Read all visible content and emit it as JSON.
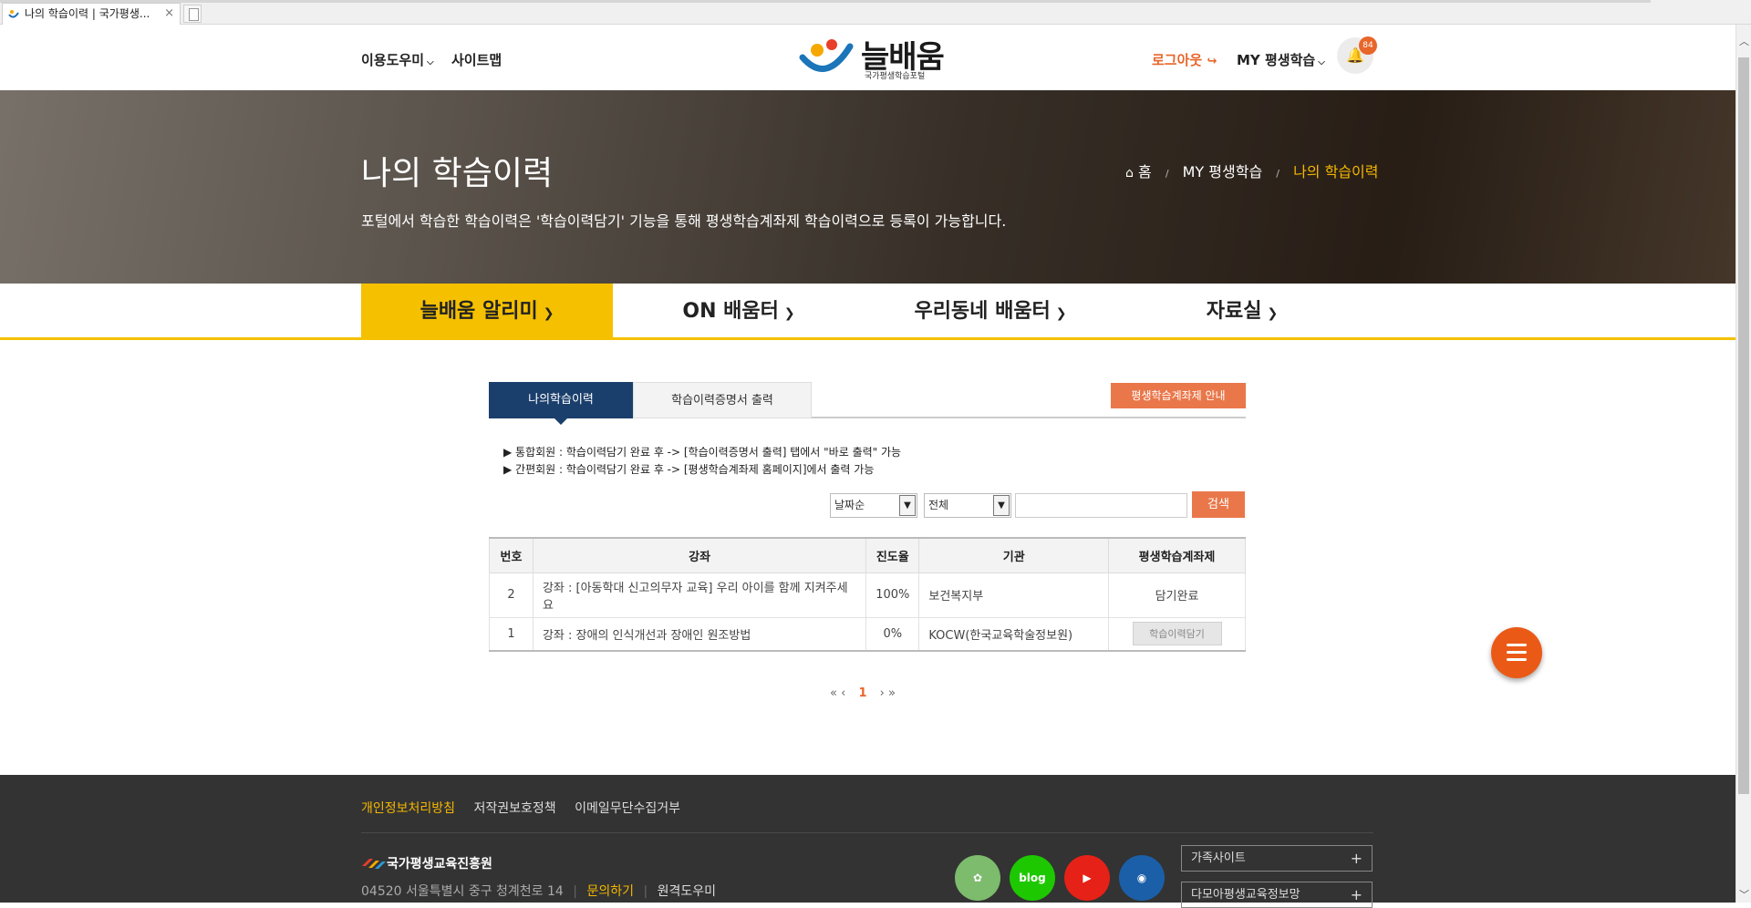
{
  "browser": {
    "tab_title": "나의 학습이력 | 국가평생...",
    "tab_close": "×"
  },
  "header": {
    "help_label": "이용도우미",
    "sitemap_label": "사이트맵",
    "logo_text": "늘배움",
    "logo_sub": "국가평생학습포털",
    "logout_label": "로그아웃",
    "my_learning_label": "MY 평생학습",
    "notification_count": "84"
  },
  "hero": {
    "title": "나의 학습이력",
    "description": "포털에서 학습한 학습이력은 '학습이력담기' 기능을 통해 평생학습계좌제 학습이력으로 등록이 가능합니다.",
    "breadcrumb": {
      "home": "홈",
      "level1": "MY 평생학습",
      "current": "나의 학습이력",
      "separator": "/"
    }
  },
  "gnb": {
    "items": [
      {
        "label": "늘배움 알리미"
      },
      {
        "label": "ON 배움터"
      },
      {
        "label": "우리동네 배움터"
      },
      {
        "label": "자료실"
      }
    ]
  },
  "content": {
    "tabs": [
      {
        "label": "나의학습이력"
      },
      {
        "label": "학습이력증명서 출력"
      }
    ],
    "guide_button": "평생학습계좌제 안내",
    "notes": [
      "▶ 통합회원 : 학습이력담기 완료 후 -> [학습이력증명서 출력] 탭에서 \"바로 출력\" 가능",
      "▶ 간편회원 : 학습이력담기 완료 후 -> [평생학습계좌제 홈페이지]에서 출력 가능"
    ],
    "search": {
      "sort_value": "날짜순",
      "filter_value": "전체",
      "query_value": "",
      "button_label": "검색"
    },
    "table": {
      "headers": [
        "번호",
        "강좌",
        "진도율",
        "기관",
        "평생학습계좌제"
      ],
      "rows": [
        {
          "no": "2",
          "title": "강좌 : [아동학대 신고의무자 교육] 우리 아이를 함께 지켜주세요",
          "progress": "100%",
          "org": "보건복지부",
          "status": "담기완료",
          "has_button": false
        },
        {
          "no": "1",
          "title": "강좌 : 장애의 인식개선과 장애인 원조방법",
          "progress": "0%",
          "org": "KOCW(한국교육학술정보원)",
          "status": "학습이력담기",
          "has_button": true
        }
      ]
    },
    "pagination": {
      "first": "«",
      "prev": "‹",
      "current": "1",
      "next": "›",
      "last": "»"
    }
  },
  "footer": {
    "links": [
      "개인정보처리방침",
      "저작권보호정책",
      "이메일무단수집거부"
    ],
    "org_name": "국가평생교육진흥원",
    "address": "04520 서울특별시 중구 청계천로 14",
    "contact_link": "문의하기",
    "remote_help": "원격도우미",
    "blog_label": "blog",
    "family_site": "가족사이트",
    "damoa_site": "다모아평생교육정보망"
  }
}
